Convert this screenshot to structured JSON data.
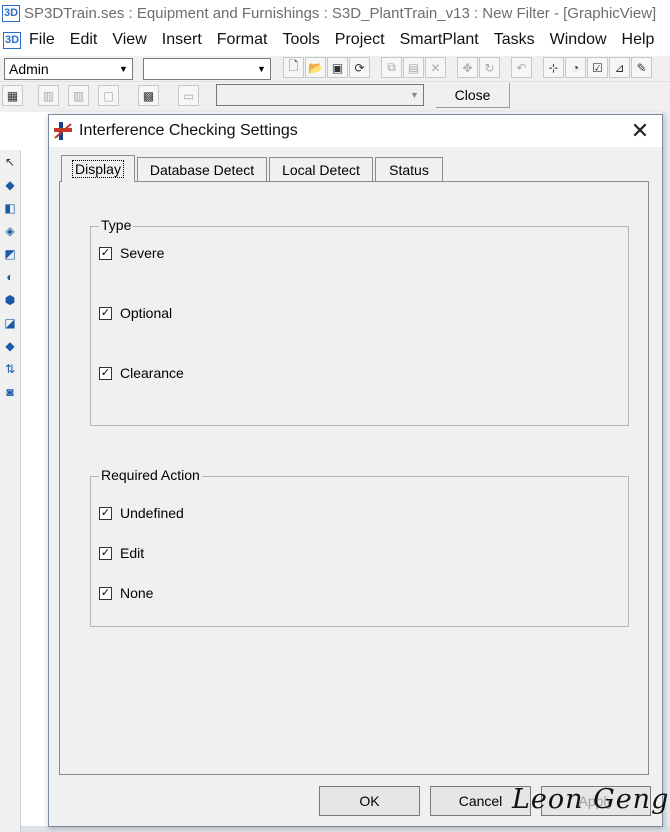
{
  "window": {
    "app_icon": "3D",
    "title": "SP3DTrain.ses : Equipment and Furnishings : S3D_PlantTrain_v13 : New Filter - [GraphicView]"
  },
  "menu": {
    "app_icon": "3D",
    "items": [
      "File",
      "Edit",
      "View",
      "Insert",
      "Format",
      "Tools",
      "Project",
      "SmartPlant",
      "Tasks",
      "Window",
      "Help"
    ]
  },
  "toolbar1": {
    "permission_group": "Admin",
    "second_combo": ""
  },
  "toolbar2": {
    "combo_value": "",
    "close_label": "Close"
  },
  "dialog": {
    "title": "Interference Checking Settings",
    "tabs": [
      "Display",
      "Database Detect",
      "Local Detect",
      "Status"
    ],
    "active_tab": "Display",
    "type_group": {
      "label": "Type",
      "options": [
        {
          "label": "Severe",
          "checked": true
        },
        {
          "label": "Optional",
          "checked": true
        },
        {
          "label": "Clearance",
          "checked": true
        }
      ]
    },
    "action_group": {
      "label": "Required Action",
      "options": [
        {
          "label": "Undefined",
          "checked": true
        },
        {
          "label": "Edit",
          "checked": true
        },
        {
          "label": "None",
          "checked": true
        }
      ]
    },
    "buttons": {
      "ok": "OK",
      "cancel": "Cancel",
      "apply": "Apply"
    }
  },
  "watermark": "Leon Geng",
  "colors": {
    "accent": "#2a6fc9",
    "dialog_bg": "#f0f0f0"
  }
}
